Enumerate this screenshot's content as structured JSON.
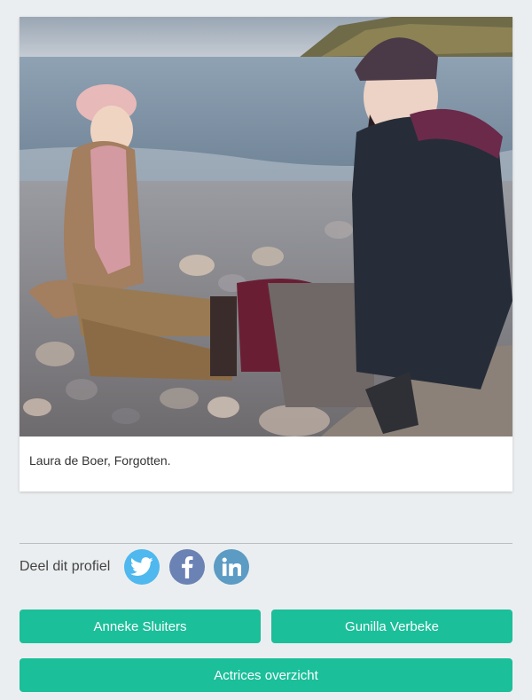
{
  "profile_card": {
    "photo_alt": "Laura de Boer, Forgotten.",
    "caption": "Laura de Boer, Forgotten."
  },
  "share": {
    "label": "Deel dit profiel",
    "networks": [
      {
        "name": "twitter",
        "icon": "twitter-icon",
        "color": "#4fb8ee"
      },
      {
        "name": "facebook",
        "icon": "facebook-icon",
        "color": "#6b82b5"
      },
      {
        "name": "linkedin",
        "icon": "linkedin-icon",
        "color": "#5b9bc4"
      }
    ]
  },
  "nav_buttons": {
    "prev_label": "Anneke Sluiters",
    "next_label": "Gunilla Verbeke",
    "overview_label": "Actrices overzicht"
  },
  "colors": {
    "accent": "#1bbf9a",
    "background": "#ebeef0"
  }
}
